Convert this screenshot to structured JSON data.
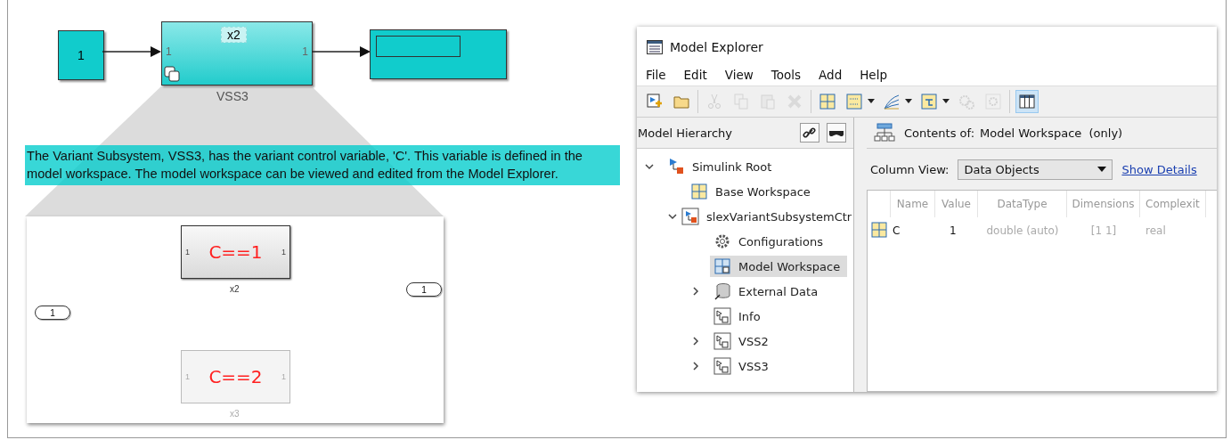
{
  "diagram": {
    "constant_block": {
      "value": "1"
    },
    "subsystem": {
      "label": "x2",
      "name": "VSS3",
      "in_port": "1",
      "out_port": "1"
    },
    "annotation": "The Variant Subsystem, VSS3, has the variant control variable, 'C'. This variable is defined in the model workspace. The model workspace can be viewed and edited from the Model Explorer.",
    "inside": {
      "inport": "1",
      "outport": "1",
      "variants": [
        {
          "condition": "C==1",
          "name": "x2",
          "in_port": "1",
          "out_port": "1",
          "active": true
        },
        {
          "condition": "C==2",
          "name": "x3",
          "in_port": "1",
          "out_port": "1",
          "active": false
        }
      ]
    }
  },
  "explorer": {
    "title": "Model Explorer",
    "menu": [
      "File",
      "Edit",
      "View",
      "Tools",
      "Add",
      "Help"
    ],
    "toolbar": [
      {
        "kind": "new-model",
        "disabled": false
      },
      {
        "kind": "open",
        "disabled": false
      },
      {
        "kind": "separator"
      },
      {
        "kind": "cut",
        "disabled": true
      },
      {
        "kind": "copy",
        "disabled": true
      },
      {
        "kind": "paste",
        "disabled": true
      },
      {
        "kind": "delete",
        "disabled": true
      },
      {
        "kind": "separator"
      },
      {
        "kind": "grid",
        "disabled": false
      },
      {
        "kind": "matrix",
        "disabled": false
      },
      {
        "kind": "dropdown"
      },
      {
        "kind": "chart",
        "disabled": false
      },
      {
        "kind": "dropdown"
      },
      {
        "kind": "bus",
        "disabled": false
      },
      {
        "kind": "dropdown"
      },
      {
        "kind": "gears",
        "disabled": true
      },
      {
        "kind": "gear",
        "disabled": true
      },
      {
        "kind": "separator"
      },
      {
        "kind": "columns",
        "disabled": false,
        "selected": true
      }
    ],
    "hierarchy": {
      "title": "Model Hierarchy",
      "tree": [
        {
          "label": "Simulink Root",
          "kind": "root",
          "expanded": true,
          "selected": false,
          "children": [
            {
              "label": "Base Workspace",
              "kind": "workspace",
              "selected": false
            },
            {
              "label": "slexVariantSubsystemCtr",
              "kind": "model",
              "expanded": true,
              "selected": false,
              "children": [
                {
                  "label": "Configurations",
                  "kind": "config",
                  "selected": false
                },
                {
                  "label": "Model Workspace",
                  "kind": "model-workspace",
                  "selected": true
                },
                {
                  "label": "External Data",
                  "kind": "data",
                  "expanded": false,
                  "selected": false
                },
                {
                  "label": "Info",
                  "kind": "subsystem",
                  "selected": false
                },
                {
                  "label": "VSS2",
                  "kind": "subsystem",
                  "expanded": false,
                  "selected": false
                },
                {
                  "label": "VSS3",
                  "kind": "subsystem",
                  "expanded": false,
                  "selected": false
                }
              ]
            }
          ]
        }
      ]
    },
    "contents": {
      "label": "Contents of:",
      "scope": "Model Workspace  (only)",
      "column_view_label": "Column View:",
      "column_view": "Data Objects",
      "link": "Show Details",
      "columns": [
        "Name",
        "Value",
        "DataType",
        "Dimensions",
        "Complexit"
      ],
      "rows": [
        {
          "cells": [
            "C",
            "1",
            "double (auto)",
            "[1 1]",
            "real"
          ]
        }
      ]
    }
  }
}
